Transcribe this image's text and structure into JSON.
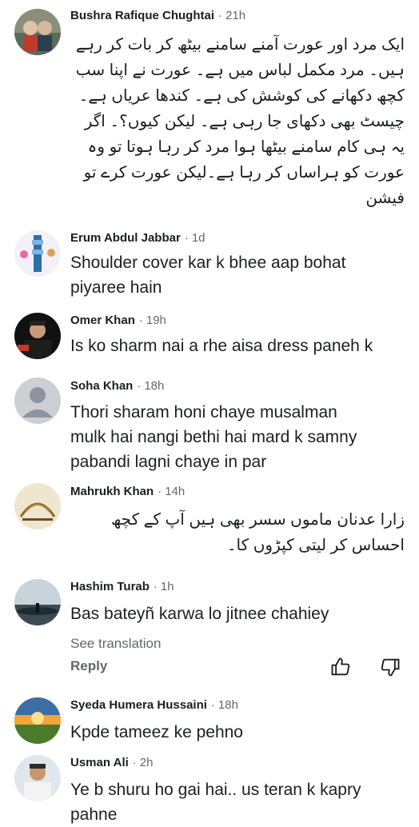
{
  "comments": [
    {
      "name": "Bushra Rafique Chughtai",
      "time": "21h",
      "text": "ایک مرد اور عورت آمنے سامنے بیٹھ کر بات کر رہے ہیں۔ مرد مکمل لباس میں ہے۔ عورت نے اپنا سب کچھ دکھانے کی کوشش کی ہے۔ کندھا عریاں ہے۔ چیسٹ بھی دکھای جا رہی ہے۔ لیکن کیوں؟۔ اگر یہ ہی کام سامنے بیٹھا ہوا مرد کر رہا ہوتا تو وہ عورت کو ہراساں کر رہا ہے۔لیکن عورت کرے تو فیشن"
    },
    {
      "name": "Erum Abdul Jabbar",
      "time": "1d",
      "lines": [
        "Shoulder cover kar k bhee aap bohat",
        "piyaree hain"
      ]
    },
    {
      "name": "Omer Khan",
      "time": "19h",
      "lines": [
        "Is ko sharm nai a rhe aisa dress paneh k"
      ]
    },
    {
      "name": "Soha Khan",
      "time": "18h",
      "lines": [
        "Thori sharam honi chaye musalman",
        "mulk hai nangi bethi hai mard k samny",
        "pabandi lagni chaye in par"
      ]
    },
    {
      "name": "Mahrukh Khan",
      "time": "14h",
      "text": "زارا عدنان ماموں سسر بھی  ہیں آپ کے کچھ احساس کر لیتی کپڑوں کا۔"
    },
    {
      "name": "Hashim Turab",
      "time": "1h",
      "lines": [
        "Bas bateyñ karwa lo jitnee chahiey"
      ],
      "see_translation": "See translation",
      "reply": "Reply"
    },
    {
      "name": "Syeda Humera Hussaini",
      "time": "18h",
      "lines": [
        "Kpde tameez ke pehno"
      ]
    },
    {
      "name": "Usman Ali",
      "time": "2h",
      "lines": [
        "Ye b shuru ho gai hai.. us teran k kapry",
        "pahne"
      ]
    }
  ],
  "separator": "·",
  "colors": {
    "name": "#1c1e21",
    "meta": "#65676b",
    "placeholder_avatar": "#ccd0d5"
  },
  "icons": [
    "like-icon",
    "dislike-icon"
  ]
}
